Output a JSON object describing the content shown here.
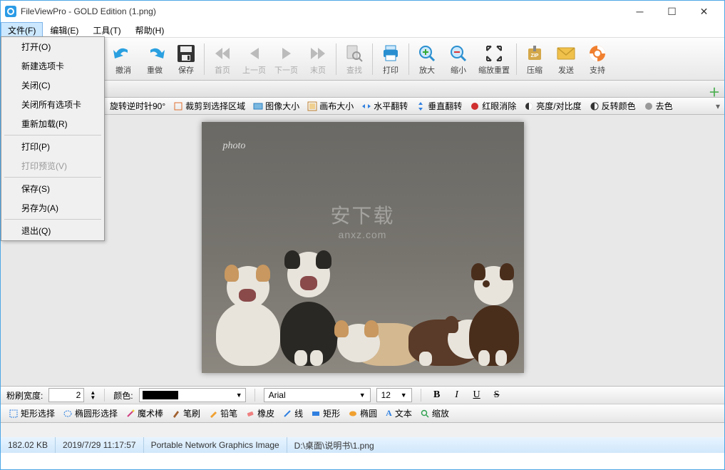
{
  "window": {
    "title": "FileViewPro - GOLD Edition (1.png)"
  },
  "menubar": {
    "file": "文件(F)",
    "edit": "编辑(E)",
    "tools": "工具(T)",
    "help": "帮助(H)"
  },
  "file_menu": {
    "open": "打开(O)",
    "newtab": "新建选项卡",
    "close": "关闭(C)",
    "closeall": "关闭所有选项卡",
    "reload": "重新加载(R)",
    "print": "打印(P)",
    "printpreview": "打印预览(V)",
    "save": "保存(S)",
    "saveas": "另存为(A)",
    "quit": "退出(Q)"
  },
  "toolbar": {
    "undo": "撤消",
    "redo": "重做",
    "save": "保存",
    "first": "首页",
    "prev": "上一页",
    "next": "下一页",
    "last": "末页",
    "find": "查找",
    "print": "打印",
    "zoomin": "放大",
    "zoomout": "缩小",
    "zoomreset": "缩放重置",
    "compress": "压缩",
    "send": "发送",
    "support": "支持"
  },
  "imgtools": {
    "rotate_ccw": "旋转逆时针90°",
    "crop": "裁剪到选择区域",
    "imgsize": "图像大小",
    "canvassize": "画布大小",
    "fliph": "水平翻转",
    "flipv": "垂直翻转",
    "redeye": "红眼消除",
    "brightcontrast": "亮度/对比度",
    "invert": "反转颜色",
    "desat": "去色"
  },
  "brush": {
    "width_label": "粉刷宽度:",
    "width_value": "2",
    "color_label": "颜色:",
    "font_name": "Arial",
    "font_size": "12"
  },
  "format": {
    "bold": "B",
    "italic": "I",
    "underline": "U",
    "strike": "S"
  },
  "tools2": {
    "rectsel": "矩形选择",
    "ellipsesel": "椭圆形选择",
    "wand": "魔术棒",
    "brush": "笔刷",
    "pencil": "铅笔",
    "eraser": "橡皮",
    "line": "线",
    "rect": "矩形",
    "ellipse": "椭圆",
    "text": "文本",
    "zoom": "缩放"
  },
  "status": {
    "size": "182.02 KB",
    "date": "2019/7/29 11:17:57",
    "type": "Portable Network Graphics Image",
    "path": "D:\\桌面\\说明书\\1.png"
  },
  "watermark": {
    "main": "安下载",
    "sub": "anxz.com"
  },
  "signature": "photo"
}
